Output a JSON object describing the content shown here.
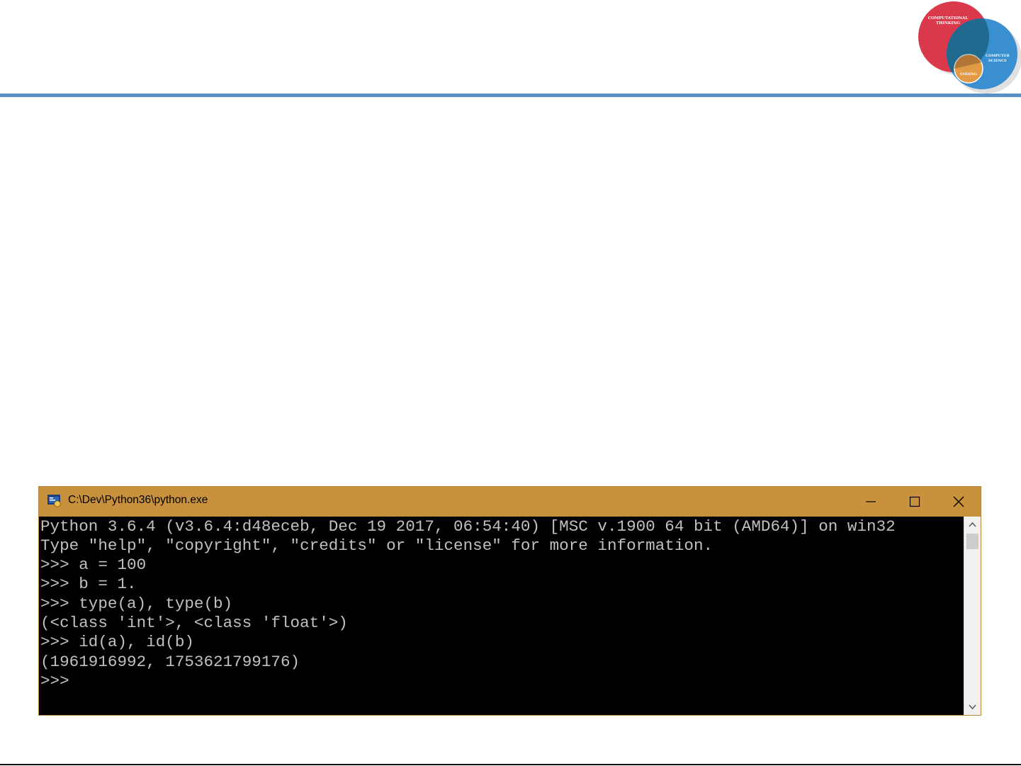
{
  "window": {
    "title": "C:\\Dev\\Python36\\python.exe",
    "titlebar_color": "#c8913e"
  },
  "console": {
    "lines": [
      "Python 3.6.4 (v3.6.4:d48eceb, Dec 19 2017, 06:54:40) [MSC v.1900 64 bit (AMD64)] on win32",
      "Type \"help\", \"copyright\", \"credits\" or \"license\" for more information.",
      ">>> a = 100",
      ">>> b = 1.",
      ">>> type(a), type(b)",
      "(<class 'int'>, <class 'float'>)",
      ">>> id(a), id(b)",
      "(1961916992, 1753621799176)",
      ">>>"
    ]
  },
  "logo": {
    "labels": [
      "COMPUTATIONAL",
      "THINKING",
      "COMPUTER",
      "SCIENCE",
      "CODING"
    ],
    "colors": {
      "red": "#d9394b",
      "blue": "#3a8fd0",
      "overlap": "#1f6a8e",
      "orange": "#e39a45"
    }
  },
  "icons": {
    "minimize": "minimize-icon",
    "maximize": "maximize-icon",
    "close": "close-icon",
    "app": "python-console-icon"
  }
}
